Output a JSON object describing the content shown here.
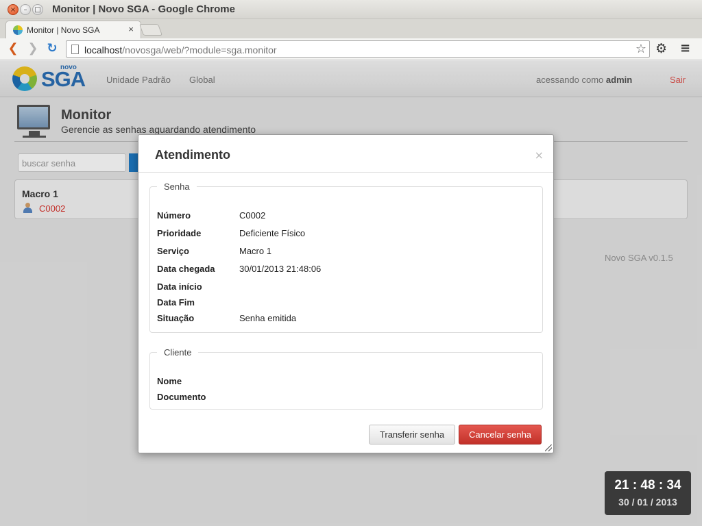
{
  "window": {
    "title": "Monitor | Novo SGA - Google Chrome",
    "close_glyph": "×",
    "min_glyph": "–",
    "max_glyph": "□"
  },
  "tab": {
    "label": "Monitor | Novo SGA",
    "close_glyph": "×"
  },
  "toolbar": {
    "url_host": "localhost",
    "url_path": "/novosga/web/?module=sga.monitor",
    "back_icon": "chevron-left-icon",
    "forward_icon": "chevron-right-icon",
    "reload_icon": "reload-icon",
    "bookmark_icon": "star-icon",
    "settings_icon": "gear-icon",
    "menu_icon": "menu-icon"
  },
  "app": {
    "logo_small": "novo",
    "logo_big": "SGA",
    "nav": [
      "Unidade Padrão",
      "Global"
    ],
    "accessing_prefix": "acessando como",
    "user": "admin",
    "logout": "Sair"
  },
  "page": {
    "title": "Monitor",
    "subtitle": "Gerencie as senhas aguardando atendimento",
    "search_placeholder": "buscar senha",
    "service": {
      "name": "Macro 1",
      "ticket": "C0002"
    },
    "version": "Novo SGA v0.1.5"
  },
  "clock": {
    "time": "21 : 48 : 34",
    "date": "30 / 01 / 2013"
  },
  "modal": {
    "title": "Atendimento",
    "close_glyph": "×",
    "senha": {
      "legend": "Senha",
      "rows": [
        {
          "label": "Número",
          "value": "C0002"
        },
        {
          "label": "Prioridade",
          "value": "Deficiente Físico"
        },
        {
          "label": "Serviço",
          "value": "Macro 1"
        },
        {
          "label": "Data chegada",
          "value": "30/01/2013 21:48:06"
        },
        {
          "label": "Data início",
          "value": ""
        },
        {
          "label": "Data Fim",
          "value": ""
        },
        {
          "label": "Situação",
          "value": "Senha emitida"
        }
      ]
    },
    "cliente": {
      "legend": "Cliente",
      "rows": [
        {
          "label": "Nome",
          "value": ""
        },
        {
          "label": "Documento",
          "value": ""
        }
      ]
    },
    "buttons": {
      "transfer": "Transferir senha",
      "cancel": "Cancelar senha"
    }
  },
  "colors": {
    "accent_blue": "#2b6fb5",
    "danger_red": "#d9312b",
    "logout_red": "#e0544f"
  }
}
